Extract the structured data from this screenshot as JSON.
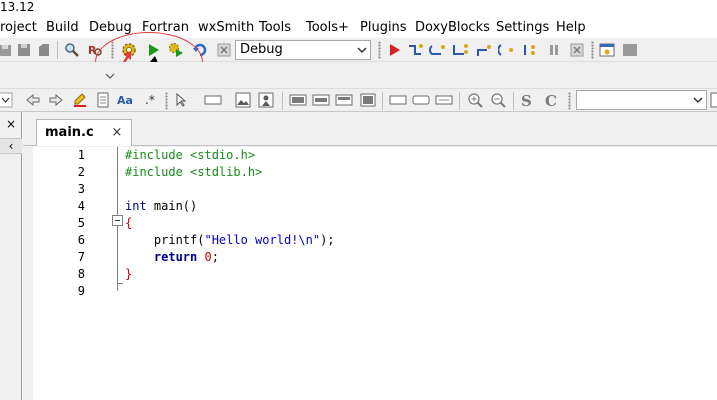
{
  "window": {
    "title": "13.12"
  },
  "menu": [
    {
      "id": "project",
      "label": "roject"
    },
    {
      "id": "build",
      "label": "Build"
    },
    {
      "id": "debug",
      "label": "Debug"
    },
    {
      "id": "fortran",
      "label": "Fortran"
    },
    {
      "id": "wxsmith",
      "label": "wxSmith"
    },
    {
      "id": "tools",
      "label": "Tools"
    },
    {
      "id": "tools-plus",
      "label": "Tools+"
    },
    {
      "id": "plugins",
      "label": "Plugins"
    },
    {
      "id": "doxyblocks",
      "label": "DoxyBlocks"
    },
    {
      "id": "settings",
      "label": "Settings"
    },
    {
      "id": "help",
      "label": "Help"
    }
  ],
  "build_target": {
    "selected": "Debug"
  },
  "search_combo": {
    "value": ""
  },
  "tabs": [
    {
      "label": "main.c",
      "close_glyph": "×"
    }
  ],
  "left_panel": {
    "close_glyph": "×",
    "collapse_glyph": "‹"
  },
  "editor": {
    "line_numbers": [
      "1",
      "2",
      "3",
      "4",
      "5",
      "6",
      "7",
      "8",
      "9"
    ],
    "lines": [
      {
        "text": "#include <stdio.h>",
        "color": "#1a8a1a"
      },
      {
        "text": "#include <stdlib.h>",
        "color": "#1a8a1a"
      },
      {
        "text": "",
        "color": "#000000"
      },
      {
        "text": "int main()",
        "color": "#000000"
      },
      {
        "text": "{",
        "color": "#cc0000"
      },
      {
        "text": "    printf(\"Hello world!\\n\");",
        "color": "#000000"
      },
      {
        "text": "    return 0;",
        "color": "#000000"
      },
      {
        "text": "}",
        "color": "#cc0000"
      },
      {
        "text": "",
        "color": "#000000"
      }
    ]
  },
  "colors": {
    "annotation_red": "#e23a3a",
    "run_green": "#1a9a1a",
    "debug_red": "#d82020",
    "keyword_blue": "#00008b",
    "string_blue": "#0000cc",
    "preprocessor_green": "#1a8a1a",
    "brace_red": "#cc0000"
  }
}
